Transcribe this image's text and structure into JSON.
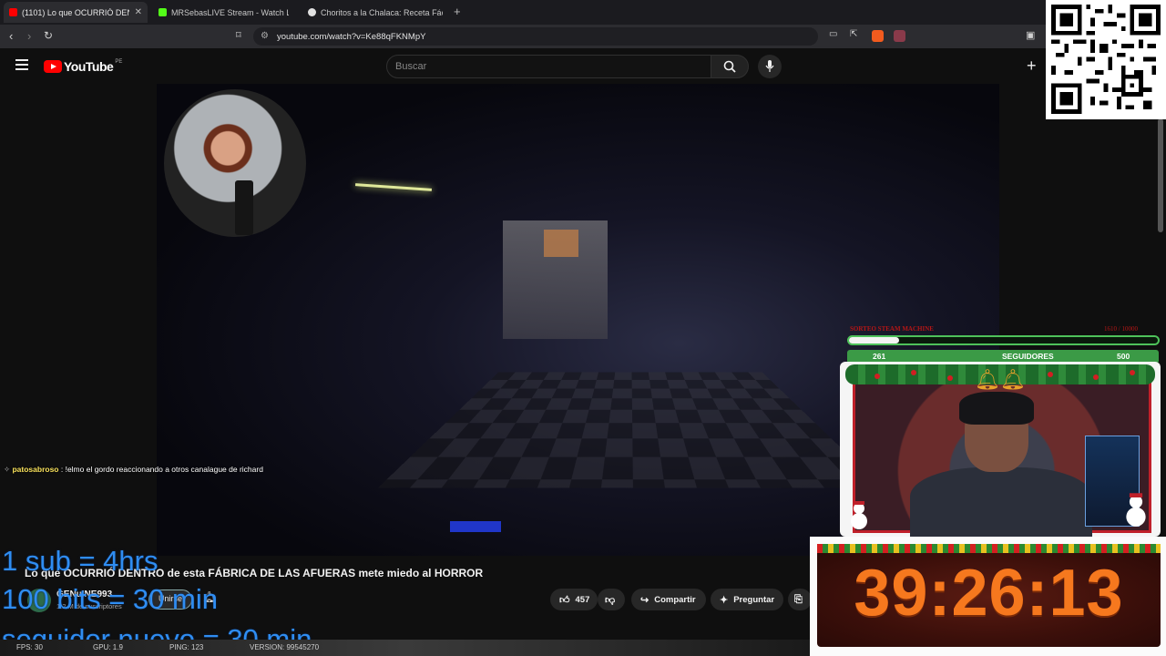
{
  "browser": {
    "tabs": [
      {
        "title": "(1101) Lo que OCURRIÓ DEN",
        "active": true,
        "favicon_color": "#ff0000"
      },
      {
        "title": "MRSebasLIVE Stream - Watch Liv",
        "active": false,
        "favicon_color": "#53fc18"
      },
      {
        "title": "Choritos a la Chalaca: Receta Fácil y S",
        "active": false,
        "favicon_color": "#e0e0e0"
      }
    ],
    "url": "youtube.com/watch?v=Ke88qFKNMpY"
  },
  "youtube": {
    "logo_text": "YouTube",
    "country_code": "PE",
    "search_placeholder": "Buscar"
  },
  "video": {
    "title": "Lo que OCURRIÓ DENTRO de esta FÁBRICA DE LAS AFUERAS mete miedo al HORROR",
    "channel": "GENuINE993",
    "subscribers": "1.2 M de suscriptores",
    "join_label": "Unirse",
    "likes": "457",
    "share_label": "Compartir",
    "ask_label": "Preguntar"
  },
  "chat": {
    "user": "patosabroso",
    "message": " : !elmo el gordo reaccionando a otros canalague de richard"
  },
  "overlay": {
    "line1": "1 sub = 4hrs",
    "line2": "100 bits = 30 min",
    "line3": "seguidor nuevo = 30 min",
    "stats": {
      "fps": "FPS: 30",
      "gpu": "GPU: 1.9",
      "ping": "PING: 123",
      "version": "VERSION: 99545270"
    },
    "goal_title": "SORTEO STEAM MACHINE",
    "goal_count": "1610 / 10000",
    "goal_progress": 0.161,
    "followers_current": "261",
    "followers_label": "SEGUIDORES",
    "followers_target": "500",
    "timer": "39:26:13"
  },
  "colors": {
    "youtube_red": "#ff0000",
    "overlay_blue": "#2f8df2",
    "timer_orange": "#f6781e",
    "goal_green": "#4ec25a"
  }
}
